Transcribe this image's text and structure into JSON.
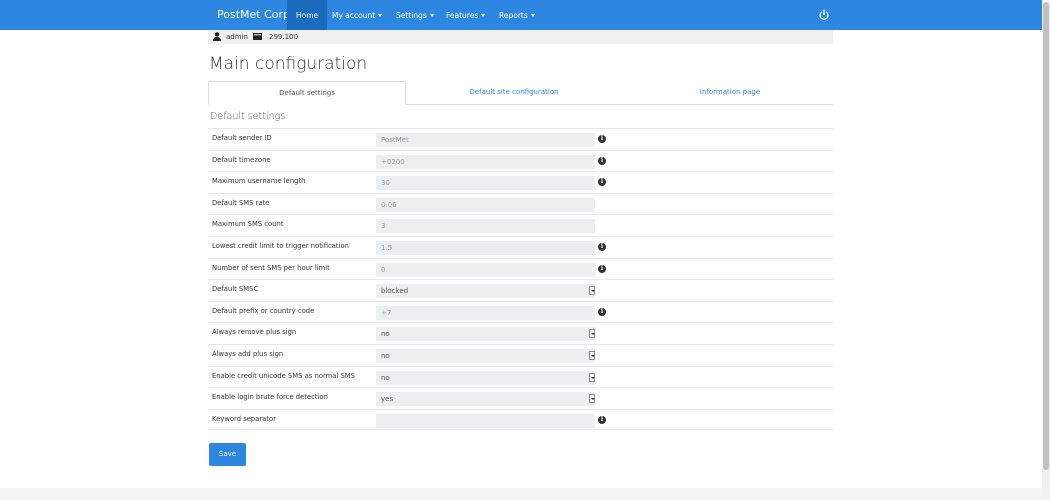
{
  "navbar": {
    "brand": "PostMet Corp.",
    "items": [
      {
        "label": "Home",
        "dropdown": false
      },
      {
        "label": "My account",
        "dropdown": true
      },
      {
        "label": "Settings",
        "dropdown": true
      },
      {
        "label": "Features",
        "dropdown": true
      },
      {
        "label": "Reports",
        "dropdown": true
      }
    ],
    "power_icon": "power-icon",
    "color": "#2d86e0"
  },
  "userbar": {
    "username": "admin",
    "balance": "299.100",
    "user_icon": "user-icon",
    "balance_icon": "money-icon"
  },
  "page": {
    "title": "Main configuration",
    "tabs": [
      "Default settings",
      "Default site configuration",
      "Information page"
    ],
    "active_tab": "Default settings",
    "section_title": "Default settings"
  },
  "settings": [
    {
      "label": "Default sender ID",
      "value": "PostMet",
      "type": "input",
      "info": true
    },
    {
      "label": "Default timezone",
      "value": "+0200",
      "type": "input",
      "info": true
    },
    {
      "label": "Maximum username length",
      "value": "30",
      "type": "input",
      "info": true
    },
    {
      "label": "Default SMS rate",
      "value": "0.06",
      "type": "input",
      "info": false
    },
    {
      "label": "Maximum SMS count",
      "value": "3",
      "type": "input",
      "info": false
    },
    {
      "label": "Lowest credit limit to trigger notification",
      "value": "1.5",
      "type": "input",
      "info": true
    },
    {
      "label": "Number of sent SMS per hour limit",
      "value": "0",
      "type": "input",
      "info": true
    },
    {
      "label": "Default SMSC",
      "value": "blocked",
      "type": "select",
      "info": false
    },
    {
      "label": "Default prefix or country code",
      "value": "+7",
      "type": "input",
      "info": true
    },
    {
      "label": "Always remove plus sign",
      "value": "no",
      "type": "select",
      "info": false
    },
    {
      "label": "Always add plus sign",
      "value": "no",
      "type": "select",
      "info": false
    },
    {
      "label": "Enable credit unicode SMS as normal SMS",
      "value": "no",
      "type": "select",
      "info": false
    },
    {
      "label": "Enable login brute force detection",
      "value": "yes",
      "type": "select",
      "info": false
    },
    {
      "label": "Keyword separator",
      "value": "",
      "type": "input",
      "info": true
    }
  ],
  "actions": {
    "save_label": "Save"
  },
  "info_icon_glyph": "i"
}
